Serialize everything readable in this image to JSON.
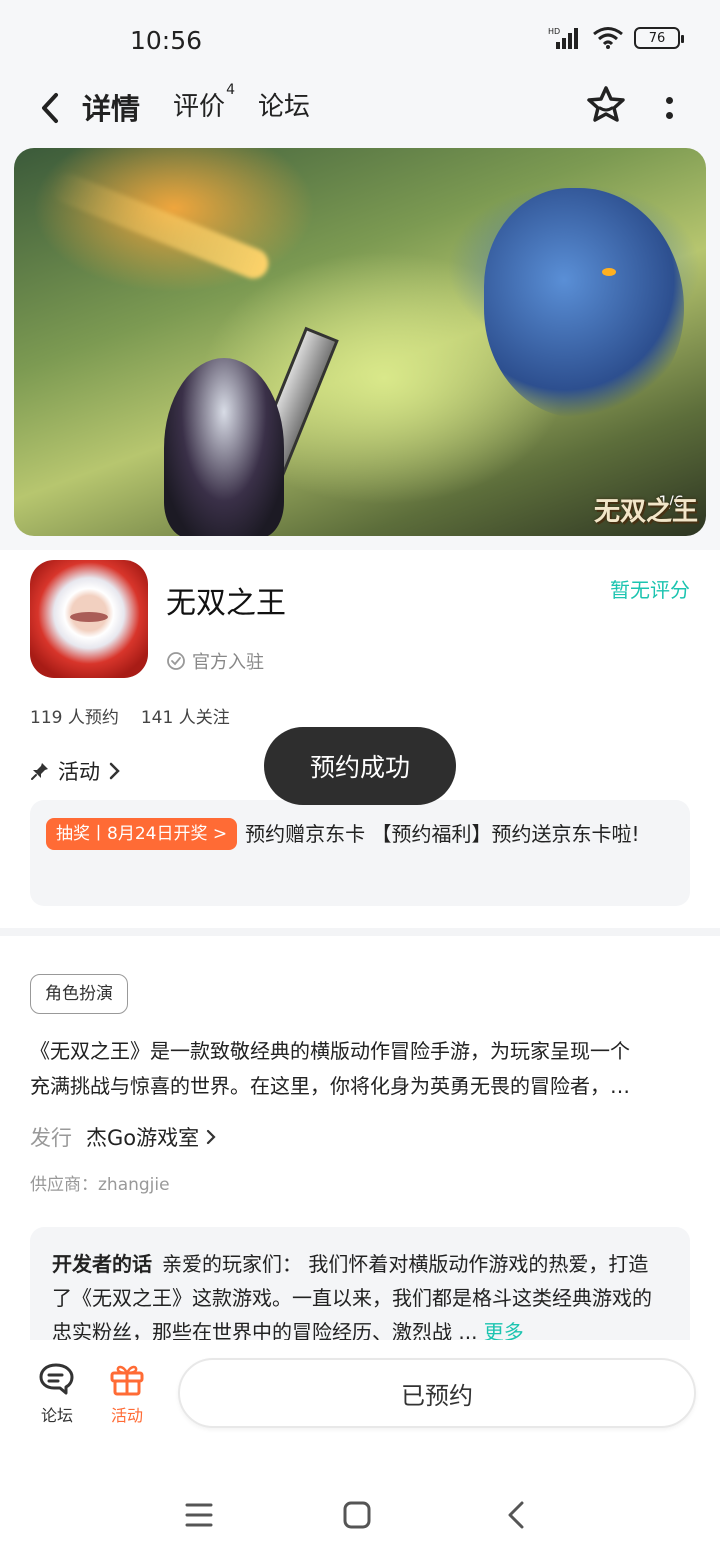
{
  "status_bar": {
    "time": "10:56",
    "battery": "76"
  },
  "nav": {
    "tabs": [
      {
        "label": "详情",
        "active": true
      },
      {
        "label": "评价",
        "badge": "4"
      },
      {
        "label": "论坛"
      }
    ]
  },
  "banner": {
    "counter": "1/6",
    "watermark": "无双之王"
  },
  "app": {
    "name": "无双之王",
    "rating_text": "暂无评分",
    "official_label": "官方入驻",
    "reservations": "119 人预约",
    "followers": "141 人关注"
  },
  "activity": {
    "label": "活动",
    "tag": "抽奖丨8月24日开奖 >",
    "text": "预约赠京东卡 【预约福利】预约送京东卡啦!"
  },
  "toast": "预约成功",
  "genre_tag": "角色扮演",
  "description": {
    "line1": "《无双之王》是一款致敬经典的横版动作冒险手游，为玩家呈现一个",
    "line2": "充满挑战与惊喜的世界。在这里，你将化身为英勇无畏的冒险者，…"
  },
  "publisher": {
    "label": "发行",
    "name": "杰Go游戏室"
  },
  "supplier": "供应商：zhangjie",
  "developer_note": {
    "title": "开发者的话",
    "text": "亲爱的玩家们： 我们怀着对横版动作游戏的热爱，打造了《无双之王》这款游戏。一直以来，我们都是格斗这类经典游戏的忠实粉丝，那些在世界中的冒险经历、激烈战 ...",
    "more": "更多"
  },
  "bottom_bar": {
    "forum_label": "论坛",
    "activity_label": "活动",
    "reserved_button": "已预约"
  },
  "colors": {
    "accent": "#1cc4b0",
    "orange": "#ff6b35",
    "toast_bg": "#2e2e2e"
  }
}
